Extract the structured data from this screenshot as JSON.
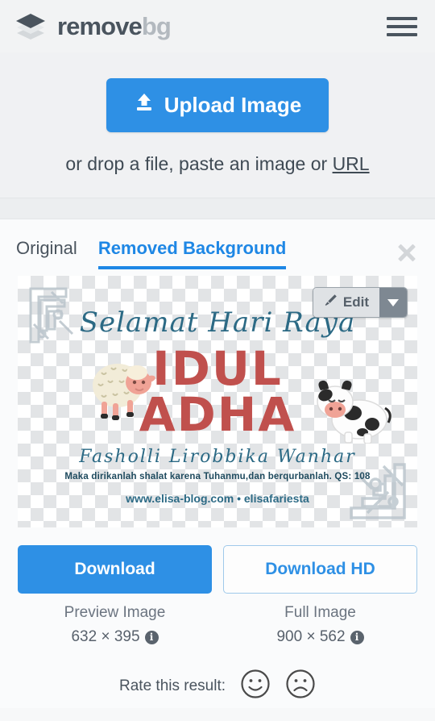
{
  "header": {
    "logo_icon": "layers-diamond-icon",
    "brand_primary": "remove",
    "brand_secondary": "bg",
    "menu_icon": "hamburger-menu-icon"
  },
  "upload": {
    "button_label": "Upload Image",
    "button_icon": "upload-arrow-icon",
    "hint_prefix": "or drop a file, paste an image or ",
    "hint_link": "URL",
    "accent_color": "#2e90e5"
  },
  "result": {
    "tabs": [
      {
        "label": "Original",
        "active": false
      },
      {
        "label": "Removed Background",
        "active": true
      }
    ],
    "close_icon": "close-x-icon",
    "edit": {
      "label": "Edit",
      "brush_icon": "paintbrush-icon",
      "caret_icon": "chevron-down-icon"
    },
    "artwork": {
      "title": "Selamat Hari Raya",
      "headline_line1": "IDUL",
      "headline_line2": "ADHA",
      "subtitle": "Fasholli Lirobbika Wanhar",
      "verse": "Maka dirikanlah shalat karena Tuhanmu,dan berqurbanlah. QS: 108",
      "website": "www.elisa-blog.com • elisafariesta",
      "headline_color": "#c0504d",
      "script_color": "#2c6a85",
      "sheep_icon": "sheep-illustration",
      "cow_icon": "cow-illustration",
      "ornament_icon": "islamic-ornament"
    }
  },
  "downloads": [
    {
      "button_label": "Download",
      "type_label": "Preview Image",
      "dimensions": "632 × 395",
      "info_icon": "info-icon",
      "style": "primary"
    },
    {
      "button_label": "Download HD",
      "type_label": "Full Image",
      "dimensions": "900 × 562",
      "info_icon": "info-icon",
      "style": "ghost"
    }
  ],
  "rating": {
    "label": "Rate this result:",
    "positive_icon": "smiley-happy-icon",
    "negative_icon": "smiley-sad-icon"
  }
}
